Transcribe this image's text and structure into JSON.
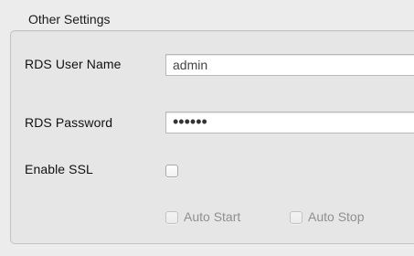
{
  "group": {
    "title": "Other Settings"
  },
  "fields": {
    "rds_user_name": {
      "label": "RDS User Name",
      "value": "admin"
    },
    "rds_password": {
      "label": "RDS Password",
      "masked_value": "••••••"
    },
    "enable_ssl": {
      "label": "Enable SSL",
      "checked": false
    }
  },
  "options": {
    "auto_start": {
      "label": "Auto Start",
      "checked": false,
      "enabled": false
    },
    "auto_stop": {
      "label": "Auto Stop",
      "checked": false,
      "enabled": false
    }
  }
}
